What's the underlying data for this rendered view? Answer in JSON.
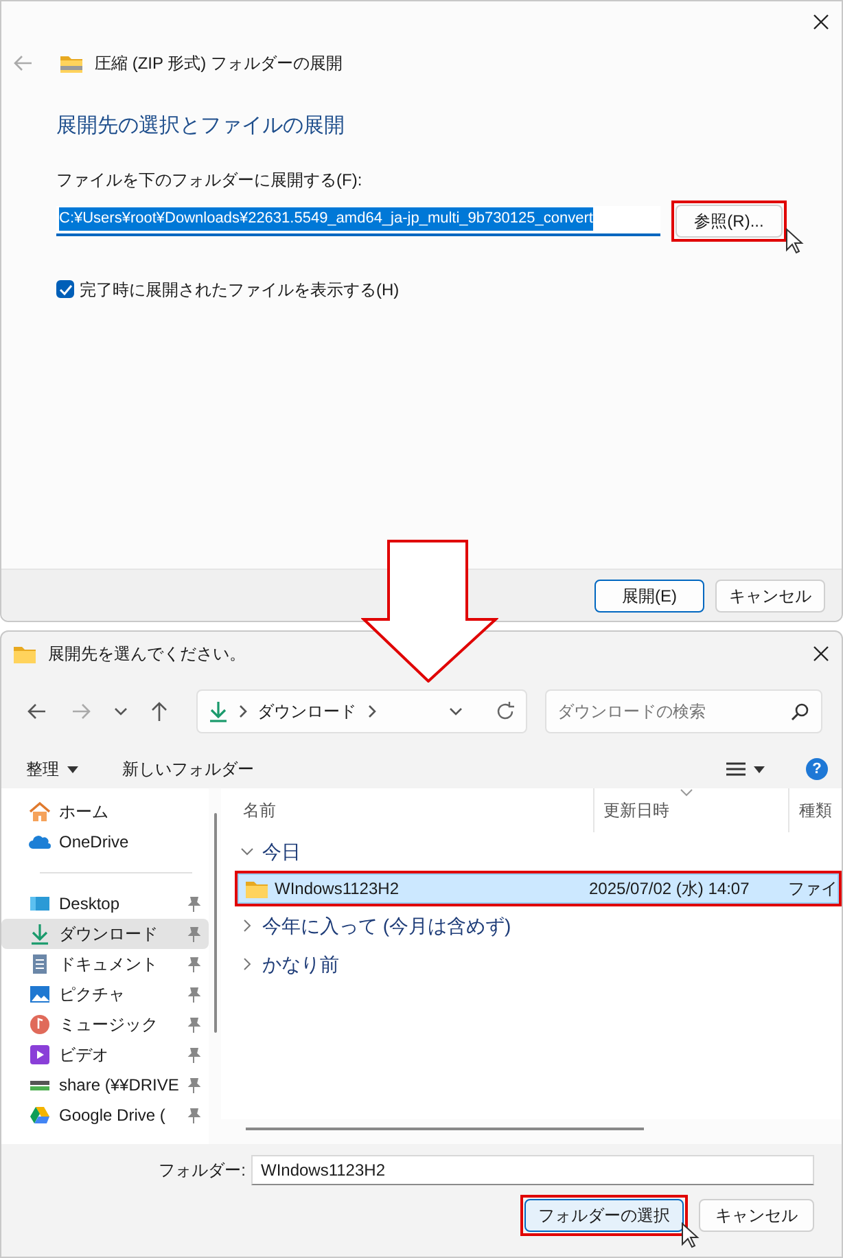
{
  "extract_dialog": {
    "title": "圧縮 (ZIP 形式) フォルダーの展開",
    "heading": "展開先の選択とファイルの展開",
    "path_label": "ファイルを下のフォルダーに展開する(F):",
    "path_value": "C:¥Users¥root¥Downloads¥22631.5549_amd64_ja-jp_multi_9b730125_convert",
    "path_selected": true,
    "browse_button": {
      "label": "参照(R)...",
      "highlighted": true
    },
    "show_files_checkbox": {
      "label": "完了時に展開されたファイルを表示する(H)",
      "checked": true
    },
    "buttons": [
      {
        "label": "展開(E)",
        "default": true
      },
      {
        "label": "キャンセル",
        "default": false
      }
    ]
  },
  "folder_dialog": {
    "title": "展開先を選んでください。",
    "breadcrumb": [
      "ダウンロード"
    ],
    "search": {
      "placeholder": "ダウンロードの検索"
    },
    "toolbar": {
      "organize": "整理",
      "new_folder": "新しいフォルダー",
      "help": "?"
    },
    "sidebar": {
      "groups": [
        [
          {
            "kind": "home",
            "label": "ホーム",
            "pinned": false,
            "selected": false
          },
          {
            "kind": "cloud",
            "label": "OneDrive",
            "pinned": false,
            "selected": false
          }
        ],
        [
          {
            "kind": "desktop",
            "label": "Desktop",
            "pinned": true,
            "selected": false
          },
          {
            "kind": "download",
            "label": "ダウンロード",
            "pinned": true,
            "selected": true
          },
          {
            "kind": "document",
            "label": "ドキュメント",
            "pinned": true,
            "selected": false
          },
          {
            "kind": "picture",
            "label": "ピクチャ",
            "pinned": true,
            "selected": false
          },
          {
            "kind": "music",
            "label": "ミュージック",
            "pinned": true,
            "selected": false
          },
          {
            "kind": "video",
            "label": "ビデオ",
            "pinned": true,
            "selected": false
          },
          {
            "kind": "drive",
            "label": "share (¥¥DRIVE",
            "pinned": true,
            "selected": false
          },
          {
            "kind": "gdrive",
            "label": "Google Drive (",
            "pinned": true,
            "selected": false
          }
        ]
      ]
    },
    "columns": [
      "名前",
      "更新日時",
      "種類"
    ],
    "groups": [
      {
        "label": "今日",
        "expanded": true,
        "rows": [
          {
            "name": "WIndows1123H2",
            "date": "2025/07/02 (水) 14:07",
            "type": "ファイ",
            "selected": true,
            "highlighted": true
          }
        ]
      },
      {
        "label": "今年に入って (今月は含めず)",
        "expanded": false
      },
      {
        "label": "かなり前",
        "expanded": false
      }
    ],
    "folder_label": "フォルダー:",
    "folder_value": "WIndows1123H2",
    "buttons": [
      {
        "label": "フォルダーの選択",
        "default": true,
        "highlighted": true
      },
      {
        "label": "キャンセル",
        "default": false
      }
    ]
  }
}
